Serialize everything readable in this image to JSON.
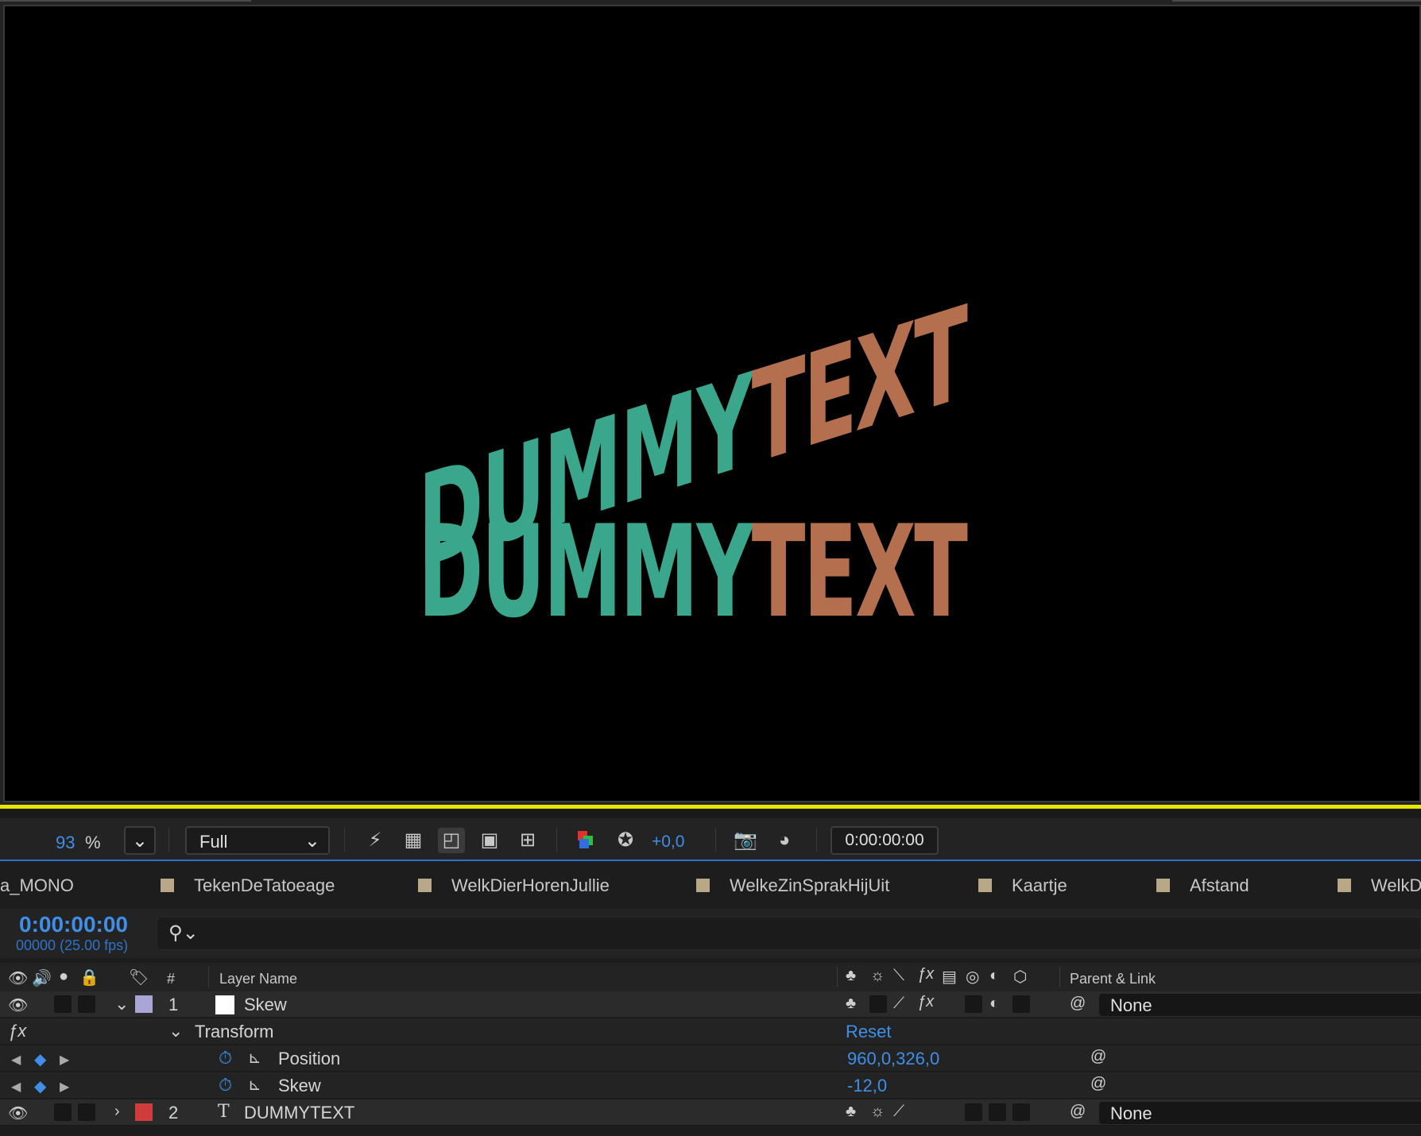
{
  "composition": {
    "line1": {
      "part1": "DUMMY",
      "part2": "TEXT"
    },
    "line2": {
      "part1": "DUMMY",
      "part2": "TEXT"
    },
    "color_part1": "#3aa68c",
    "color_part2": "#b4704e"
  },
  "viewer_toolbar": {
    "zoom_value": "93",
    "zoom_unit": "%",
    "resolution": "Full",
    "exposure": "+0,0",
    "timecode": "0:00:00:00"
  },
  "tabs": [
    {
      "label": "a_MONO"
    },
    {
      "label": "TekenDeTatoeage"
    },
    {
      "label": "WelkDierHorenJullie"
    },
    {
      "label": "WelkeZinSprakHijUit"
    },
    {
      "label": "Kaartje"
    },
    {
      "label": "Afstand"
    },
    {
      "label": "WelkD"
    }
  ],
  "timeline": {
    "current_time": "0:00:00:00",
    "frames": "00000 (25.00 fps)",
    "columns": {
      "num": "#",
      "layer_name": "Layer Name",
      "parent": "Parent & Link"
    },
    "layers": [
      {
        "index": "1",
        "name": "Skew",
        "label_color": "#a9a6d6",
        "parent": "None",
        "transform": {
          "label": "Transform",
          "reset": "Reset"
        },
        "properties": [
          {
            "name": "Position",
            "value": "960,0,326,0"
          },
          {
            "name": "Skew",
            "value": "-12,0"
          }
        ]
      },
      {
        "index": "2",
        "name": "DUMMYTEXT",
        "type_glyph": "T",
        "label_color": "#d03b3b",
        "parent": "None"
      }
    ]
  }
}
